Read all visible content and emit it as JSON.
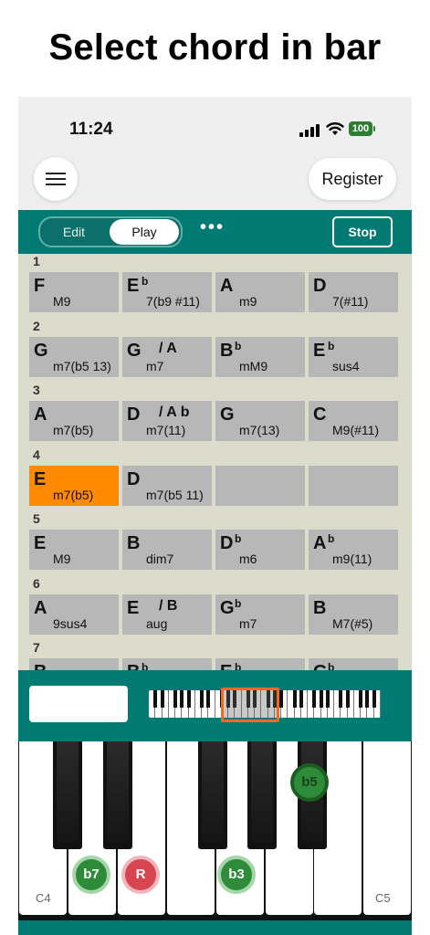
{
  "headline": "Select chord in bar",
  "status": {
    "time": "11:24",
    "battery": "100"
  },
  "header": {
    "register_label": "Register"
  },
  "toolbar": {
    "edit_label": "Edit",
    "play_label": "Play",
    "more_label": "•••",
    "stop_label": "Stop"
  },
  "bars": [
    {
      "num": "1",
      "chords": [
        {
          "root": "F",
          "acc": "",
          "slash": "",
          "qual": "M9"
        },
        {
          "root": "E",
          "acc": "b",
          "slash": "",
          "qual": "7(b9 #11)"
        },
        {
          "root": "A",
          "acc": "",
          "slash": "",
          "qual": "m9"
        },
        {
          "root": "D",
          "acc": "",
          "slash": "",
          "qual": "7(#11)"
        }
      ]
    },
    {
      "num": "2",
      "chords": [
        {
          "root": "G",
          "acc": "",
          "slash": "",
          "qual": "m7(b5 13)"
        },
        {
          "root": "G",
          "acc": "",
          "slash": "/ A",
          "qual": "m7"
        },
        {
          "root": "B",
          "acc": "b",
          "slash": "",
          "qual": "mM9"
        },
        {
          "root": "E",
          "acc": "b",
          "slash": "",
          "qual": "sus4"
        }
      ]
    },
    {
      "num": "3",
      "chords": [
        {
          "root": "A",
          "acc": "",
          "slash": "",
          "qual": "m7(b5)"
        },
        {
          "root": "D",
          "acc": "",
          "slash": "/ A b",
          "qual": "m7(11)"
        },
        {
          "root": "G",
          "acc": "",
          "slash": "",
          "qual": "m7(13)"
        },
        {
          "root": "C",
          "acc": "",
          "slash": "",
          "qual": "M9(#11)"
        }
      ]
    },
    {
      "num": "4",
      "chords": [
        {
          "root": "E",
          "acc": "",
          "slash": "",
          "qual": "m7(b5)",
          "selected": true
        },
        {
          "root": "D",
          "acc": "",
          "slash": "",
          "qual": "m7(b5 11)"
        },
        {
          "root": "",
          "acc": "",
          "slash": "",
          "qual": ""
        },
        {
          "root": "",
          "acc": "",
          "slash": "",
          "qual": ""
        }
      ]
    },
    {
      "num": "5",
      "chords": [
        {
          "root": "E",
          "acc": "",
          "slash": "",
          "qual": "M9"
        },
        {
          "root": "B",
          "acc": "",
          "slash": "",
          "qual": "dim7"
        },
        {
          "root": "D",
          "acc": "b",
          "slash": "",
          "qual": "m6"
        },
        {
          "root": "A",
          "acc": "b",
          "slash": "",
          "qual": "m9(11)"
        }
      ]
    },
    {
      "num": "6",
      "chords": [
        {
          "root": "A",
          "acc": "",
          "slash": "",
          "qual": "9sus4"
        },
        {
          "root": "E",
          "acc": "",
          "slash": "/ B",
          "qual": "aug"
        },
        {
          "root": "G",
          "acc": "b",
          "slash": "",
          "qual": "m7"
        },
        {
          "root": "B",
          "acc": "",
          "slash": "",
          "qual": "M7(#5)"
        }
      ]
    },
    {
      "num": "7",
      "chords": [
        {
          "root": "B",
          "acc": "",
          "slash": "",
          "qual": ""
        },
        {
          "root": "B",
          "acc": "b",
          "slash": "",
          "qual": ""
        },
        {
          "root": "E",
          "acc": "b",
          "slash": "",
          "qual": ""
        },
        {
          "root": "G",
          "acc": "b",
          "slash": "",
          "qual": ""
        }
      ]
    }
  ],
  "keyboard": {
    "left_label": "C4",
    "right_label": "C5",
    "marks": [
      {
        "label": "b7",
        "style": "green"
      },
      {
        "label": "R",
        "style": "red"
      },
      {
        "label": "b3",
        "style": "green"
      },
      {
        "label": "b5",
        "style": "green-dark"
      }
    ]
  },
  "colors": {
    "teal": "#007a73",
    "selected": "#ff8a00",
    "cell": "#b7b7b7",
    "grid_bg": "#dcdccc",
    "range": "#f26a21"
  }
}
